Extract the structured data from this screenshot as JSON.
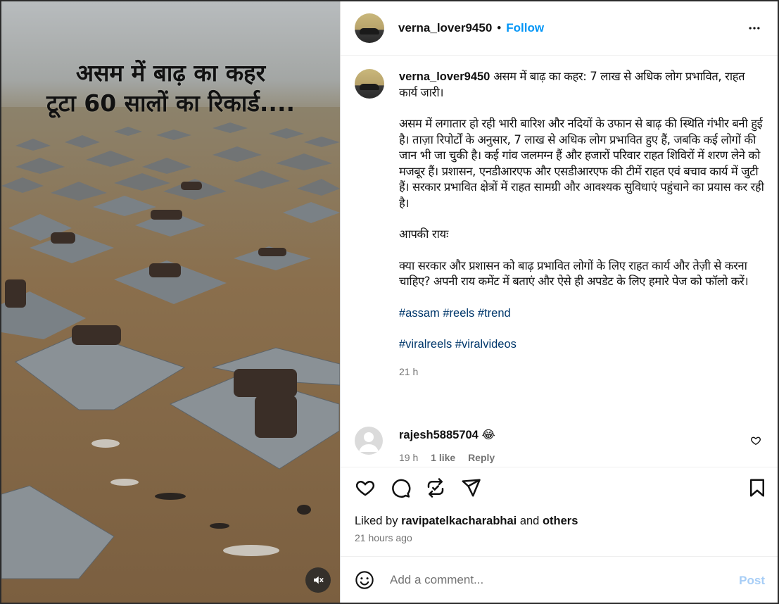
{
  "media": {
    "overlay_line1": "असम में बाढ़ का कहर",
    "overlay_line2": "टूटा 60 सालों का रिकार्ड...."
  },
  "header": {
    "username": "verna_lover9450",
    "separator": "•",
    "follow_label": "Follow"
  },
  "caption": {
    "username": "verna_lover9450",
    "headline": "असम में बाढ़ का कहर: 7 लाख से अधिक लोग प्रभावित, राहत कार्य जारी।",
    "body": "असम में लगातार हो रही भारी बारिश और नदियों के उफान से बाढ़ की स्थिति गंभीर बनी हुई है। ताज़ा रिपोर्टों के अनुसार, 7 लाख से अधिक लोग प्रभावित हुए हैं, जबकि कई लोगों की जान भी जा चुकी है। कई गांव जलमग्न हैं और हजारों परिवार राहत शिविरों में शरण लेने को मजबूर हैं। प्रशासन, एनडीआरएफ और एसडीआरएफ की टीमें राहत एवं बचाव कार्य में जुटी हैं। सरकार प्रभावित क्षेत्रों में राहत सामग्री और आवश्यक सुविधाएं पहुंचाने का प्रयास कर रही है।",
    "opinion_heading": "आपकी रायः",
    "question": "क्या सरकार और प्रशासन को बाढ़ प्रभावित लोगों के लिए राहत कार्य और तेज़ी से करना चाहिए? अपनी राय कमेंट में बताएं और ऐसे ही अपडेट के लिए हमारे पेज को फॉलो करें।",
    "hashtags_line1": "#assam #reels #trend",
    "hashtags_line2": "#viralreels #viralvideos",
    "time": "21 h"
  },
  "comment": {
    "username": "rajesh5885704",
    "text": "😂",
    "time": "19 h",
    "likes": "1 like",
    "reply_label": "Reply"
  },
  "likes": {
    "prefix": "Liked by",
    "user": "ravipatelkacharabhai",
    "conjunction": "and",
    "others": "others"
  },
  "post_time": "21 hours ago",
  "add_comment": {
    "placeholder": "Add a comment...",
    "post_label": "Post"
  },
  "colors": {
    "accent": "#0095f6",
    "hashtag": "#00376b",
    "muted": "#737373",
    "post_disabled": "#a6cdf6"
  }
}
